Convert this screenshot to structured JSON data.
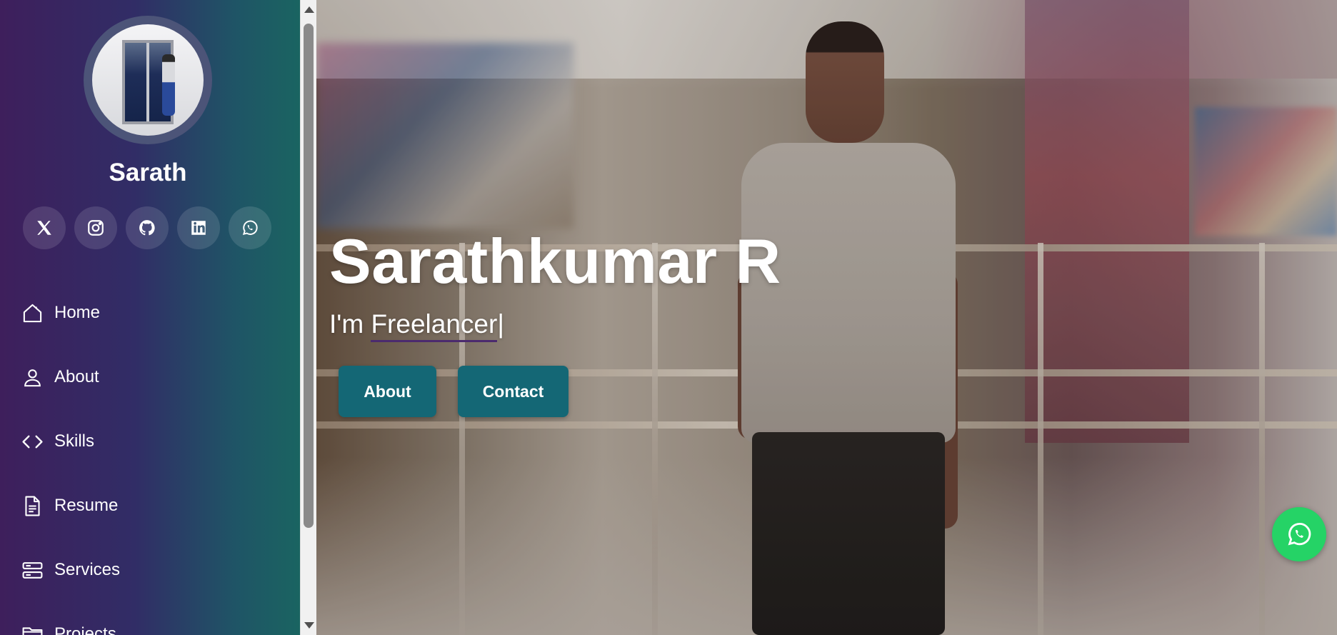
{
  "sidebar": {
    "name": "Sarath",
    "socials": [
      {
        "icon": "x-twitter-icon"
      },
      {
        "icon": "instagram-icon"
      },
      {
        "icon": "github-icon"
      },
      {
        "icon": "linkedin-icon"
      },
      {
        "icon": "whatsapp-icon"
      }
    ],
    "nav": [
      {
        "label": "Home",
        "icon": "home-icon"
      },
      {
        "label": "About",
        "icon": "person-icon"
      },
      {
        "label": "Skills",
        "icon": "code-icon"
      },
      {
        "label": "Resume",
        "icon": "document-icon"
      },
      {
        "label": "Services",
        "icon": "server-icon"
      },
      {
        "label": "Projects",
        "icon": "folder-icon"
      }
    ]
  },
  "hero": {
    "title": "Sarathkumar R",
    "typed_prefix": "I'm ",
    "typed_role": "Freelancer",
    "caret": "|",
    "buttons": {
      "about": "About",
      "contact": "Contact"
    }
  },
  "floating": {
    "icon": "whatsapp-icon",
    "color": "#25d366"
  },
  "colors": {
    "sidebar_gradient_start": "#3e1f5c",
    "sidebar_gradient_end": "#1a6461",
    "button_bg": "#146775",
    "underline": "#4b2a6e"
  }
}
